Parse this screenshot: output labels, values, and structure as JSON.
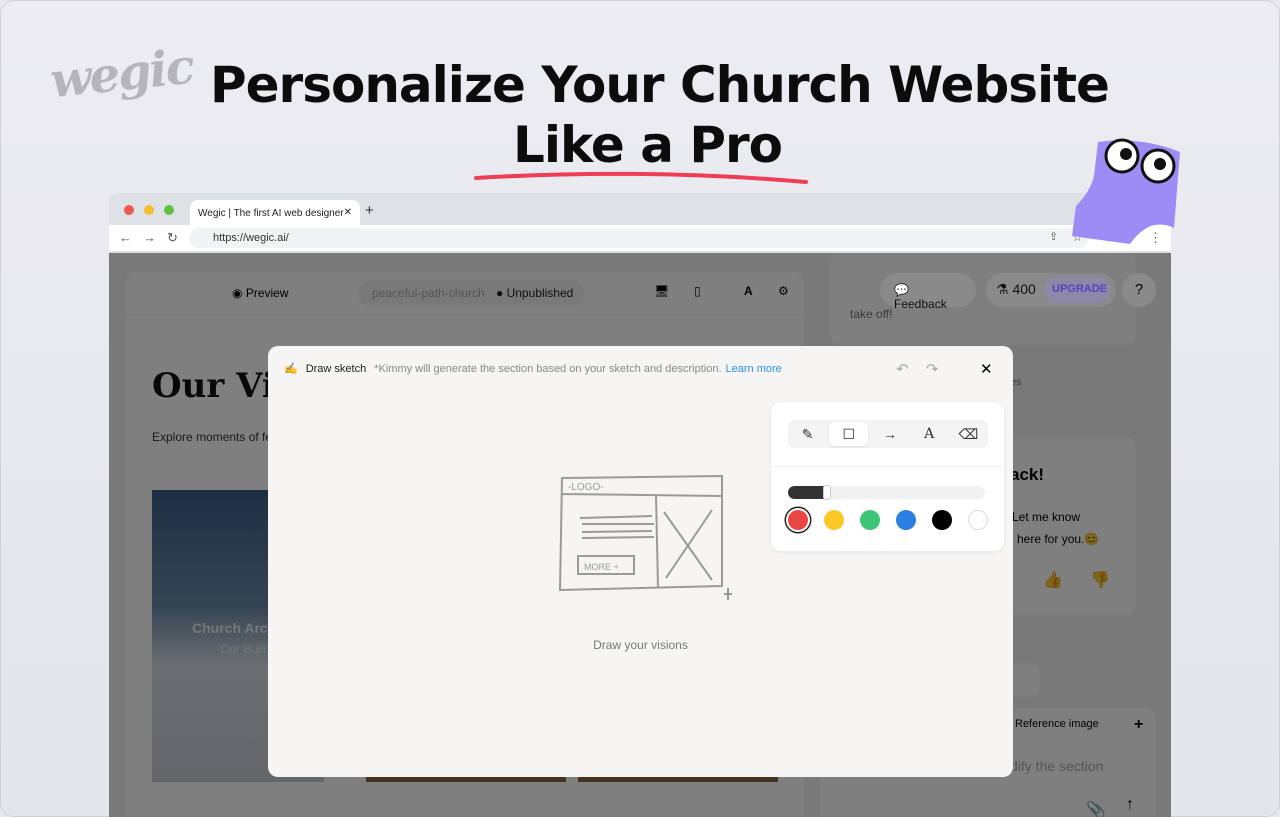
{
  "banner": {
    "logo": "wegic",
    "title_line1": "Personalize Your Church Website",
    "title_line2": "Like a Pro",
    "accent": "#ef3d55"
  },
  "browser": {
    "tab_title": "Wegic | The first AI web designer",
    "url": "https://wegic.ai/"
  },
  "app": {
    "header": {
      "preview": "Preview",
      "site_name": "peaceful-path-church",
      "status": "Unpublished"
    },
    "page": {
      "heading": "Our Vibr",
      "subtext": "Explore moments of fel",
      "card_title": "Church Archi",
      "card_sub": "Our Build"
    },
    "right": {
      "feedback": "Feedback",
      "credits": "400",
      "upgrade": "UPGRADE",
      "help": "?",
      "msg_top": "take off!",
      "divider_label": "ges",
      "greeting": "ack!",
      "msg_line1": "Let me know",
      "msg_line2": "here for you.😊",
      "reference": "Reference image",
      "input_placeholder": "dify the section"
    }
  },
  "modal": {
    "title": "Draw sketch",
    "hint": "*Kimmy will generate the section based on your sketch and description.",
    "learn_more": "Learn more",
    "empty_text": "Draw your visions",
    "sketch_logo": "-LOGO-",
    "sketch_button": "MORE +",
    "tools": [
      "pencil-icon",
      "rectangle-icon",
      "arrow-icon",
      "text-icon",
      "eraser-icon"
    ],
    "active_tool": "rectangle",
    "stroke_level": 0.2,
    "colors": [
      "#e84545",
      "#fcc828",
      "#3cc577",
      "#2a7fe0",
      "#000000",
      "#ffffff"
    ],
    "selected_color": "#e84545"
  }
}
